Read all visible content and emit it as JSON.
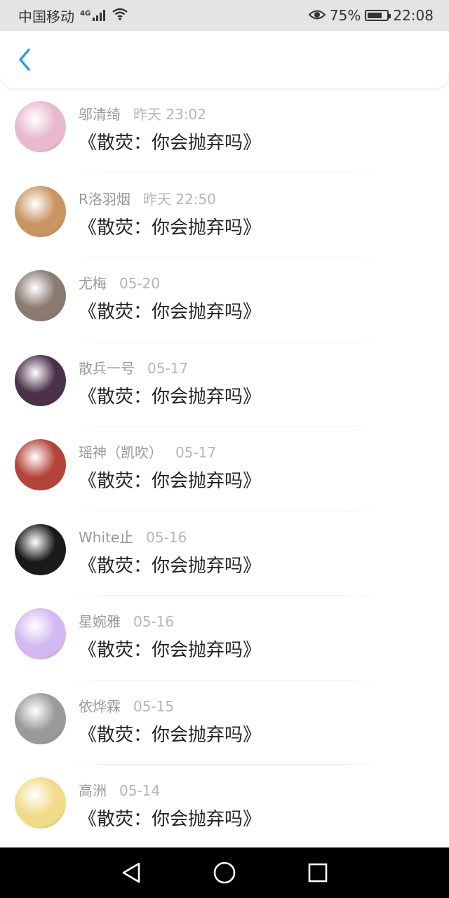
{
  "status_bar": {
    "carrier": "中国移动",
    "network": "4G",
    "battery_percent": "75%",
    "battery_level": 0.75,
    "time": "22:08",
    "icons": [
      "signal-icon",
      "wifi-icon",
      "eye-icon",
      "battery-icon"
    ]
  },
  "header": {
    "back_icon": "chevron-left-icon",
    "accent_color": "#2a9bef"
  },
  "list": {
    "items": [
      {
        "name": "邬清绮",
        "time": "昨天 23:02",
        "message": "《散荧：你会抛弃吗》",
        "avatar": "#e9b8cf"
      },
      {
        "name": "R洛羽烟",
        "time": "昨天 22:50",
        "message": "《散荧：你会抛弃吗》",
        "avatar": "#c89560"
      },
      {
        "name": "尤梅",
        "time": "05-20",
        "message": "《散荧：你会抛弃吗》",
        "avatar": "#8a7a70"
      },
      {
        "name": "散兵一号",
        "time": "05-17",
        "message": "《散荧：你会抛弃吗》",
        "avatar": "#4a3048"
      },
      {
        "name": "瑶神（凯吹）",
        "time": "05-17",
        "message": "《散荧：你会抛弃吗》",
        "avatar": "#b4443a"
      },
      {
        "name": "White止",
        "time": "05-16",
        "message": "《散荧：你会抛弃吗》",
        "avatar": "#1a1a1a"
      },
      {
        "name": "星婉雅",
        "time": "05-16",
        "message": "《散荧：你会抛弃吗》",
        "avatar": "#d4b8f0"
      },
      {
        "name": "依烨霖",
        "time": "05-15",
        "message": "《散荧：你会抛弃吗》",
        "avatar": "#9a9a9a"
      },
      {
        "name": "高洲",
        "time": "05-14",
        "message": "《散荧：你会抛弃吗》",
        "avatar": "#f0dc88"
      }
    ]
  },
  "nav_bar": {
    "icons": [
      "back-triangle-icon",
      "home-circle-icon",
      "recents-square-icon"
    ]
  }
}
